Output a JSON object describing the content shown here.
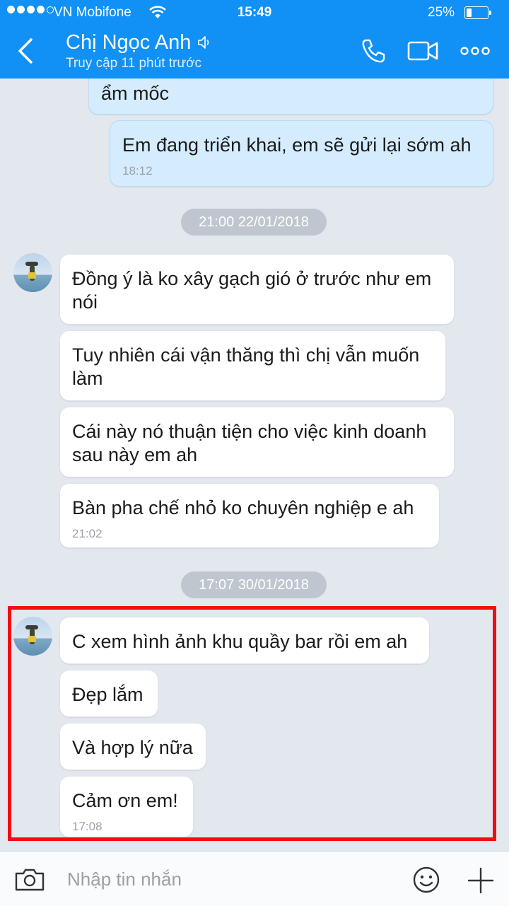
{
  "status_bar": {
    "carrier": "VN Mobifone",
    "time": "15:49",
    "battery_percent": "25%",
    "battery_level": 0.25,
    "signal_bars": 4
  },
  "header": {
    "contact_name": "Chị Ngọc Anh",
    "last_seen": "Truy cập 11 phút trước",
    "icons": [
      "back-chevron-icon",
      "speaker-icon",
      "phone-icon",
      "video-camera-icon",
      "more-dots-icon"
    ]
  },
  "messages": {
    "m1": {
      "text": "ẩm mốc"
    },
    "m2": {
      "text": "Em đang triển khai, em sẽ gửi lại sớm ah",
      "time": "18:12"
    },
    "d1": "21:00 22/01/2018",
    "m3": {
      "text": "Đồng ý là ko xây gạch gió ở trước như em nói"
    },
    "m4": {
      "text": "Tuy nhiên cái vận thăng thì chị vẫn muốn làm"
    },
    "m5": {
      "text": "Cái này nó thuận tiện cho việc kinh doanh sau này em ah"
    },
    "m6": {
      "text": "Bàn pha chế nhỏ ko chuyên nghiệp e ah",
      "time": "21:02"
    },
    "d2": "17:07 30/01/2018",
    "m7": {
      "text": "C xem hình ảnh khu quầy bar rồi em ah"
    },
    "m8": {
      "text": "Đẹp lắm"
    },
    "m9": {
      "text": "Và hợp lý nữa"
    },
    "m10": {
      "text": "Cảm ơn em!",
      "time": "17:08"
    }
  },
  "composer": {
    "placeholder": "Nhập tin nhắn",
    "icons": [
      "camera-icon",
      "emoji-icon",
      "plus-icon"
    ]
  },
  "colors": {
    "header_bg": "#1190f5",
    "chat_bg": "#e3e8ef",
    "my_bubble": "#d4ecfd",
    "their_bubble": "#ffffff",
    "highlight": "#f00e14"
  }
}
